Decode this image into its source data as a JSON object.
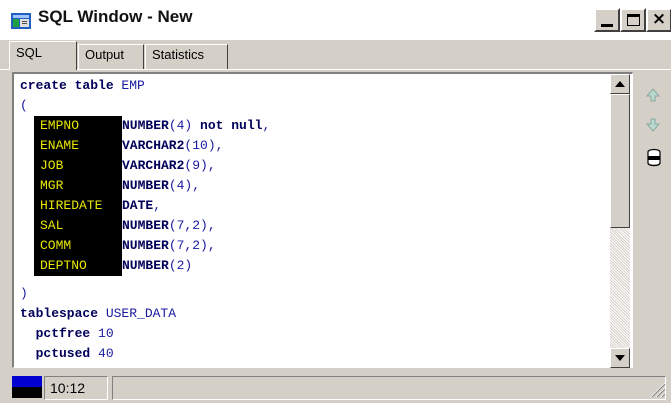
{
  "window": {
    "title": "SQL Window - New"
  },
  "tabs": [
    {
      "label": "SQL",
      "active": true
    },
    {
      "label": "Output",
      "active": false
    },
    {
      "label": "Statistics",
      "active": false
    }
  ],
  "editor": {
    "statement": {
      "line1_kw": "create table",
      "line1_name": " EMP",
      "open_paren": "(",
      "close_paren": ")"
    },
    "columns": [
      {
        "name": "EMPNO",
        "type": "NUMBER",
        "args": "(4)",
        "suffix": " not null",
        "tail": ","
      },
      {
        "name": "ENAME",
        "type": "VARCHAR2",
        "args": "(10)",
        "suffix": "",
        "tail": ","
      },
      {
        "name": "JOB",
        "type": "VARCHAR2",
        "args": "(9)",
        "suffix": "",
        "tail": ","
      },
      {
        "name": "MGR",
        "type": "NUMBER",
        "args": "(4)",
        "suffix": "",
        "tail": ","
      },
      {
        "name": "HIREDATE",
        "type": "DATE",
        "args": "",
        "suffix": "",
        "tail": ","
      },
      {
        "name": "SAL",
        "type": "NUMBER",
        "args": "(7,2)",
        "suffix": "",
        "tail": ","
      },
      {
        "name": "COMM",
        "type": "NUMBER",
        "args": "(7,2)",
        "suffix": "",
        "tail": ","
      },
      {
        "name": "DEPTNO",
        "type": "NUMBER",
        "args": "(2)",
        "suffix": "",
        "tail": ""
      }
    ],
    "storage": {
      "tablespace_kw": "tablespace",
      "tablespace_name": " USER_DATA",
      "pctfree_kw": "  pctfree",
      "pctfree_val": " 10",
      "pctused_kw": "  pctused",
      "pctused_val": " 40"
    }
  },
  "side_tools": {
    "up_icon": "arrow-up-icon",
    "down_icon": "arrow-down-icon",
    "db_icon": "database-icon"
  },
  "statusbar": {
    "position": "10:12"
  },
  "colors": {
    "code_text": "#1a1aa0",
    "keyword": "#00005a",
    "column_highlight_bg": "#000000",
    "column_highlight_fg": "#e8e800",
    "status_blue": "#0000d0"
  }
}
